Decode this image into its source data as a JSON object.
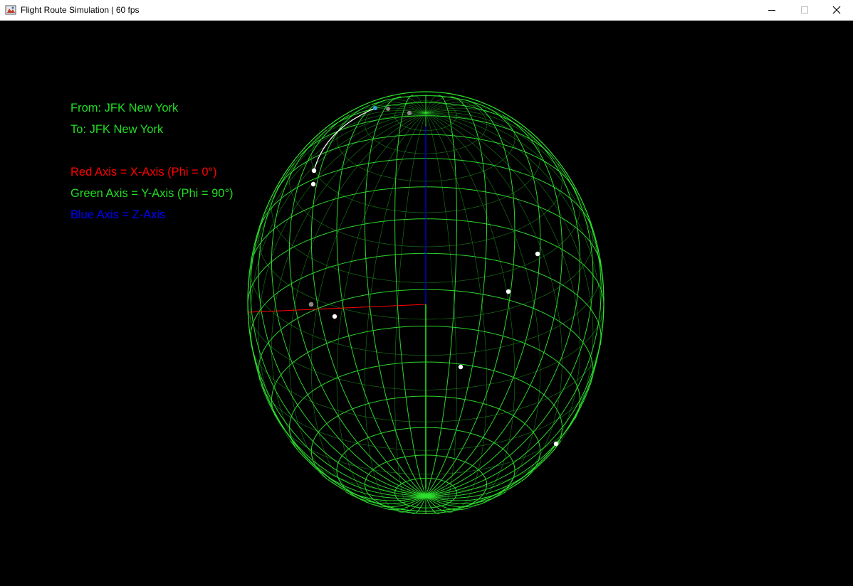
{
  "window": {
    "title": "Flight Route Simulation | 60 fps",
    "controls": {
      "minimize_icon": "minimize-icon",
      "maximize_icon": "maximize-icon",
      "close_icon": "close-icon"
    }
  },
  "overlay": {
    "from_label": "From: JFK New York",
    "to_label": "To: JFK New York",
    "red_axis_label": "Red Axis = X-Axis (Phi = 0°)",
    "green_axis_label": "Green Axis = Y-Axis (Phi = 90°)",
    "blue_axis_label": "Blue Axis = Z-Axis"
  },
  "colors": {
    "background": "#000000",
    "wireframe": "#2ee02e",
    "from_to_text": "#22dd22",
    "red_axis": "#ff0000",
    "green_axis": "#22dd22",
    "blue_axis": "#0000ff",
    "city_marker": "#ffffff",
    "inactive_marker": "#888888",
    "plane_marker": "#3a9fd8"
  },
  "globe": {
    "meridians": 36,
    "parallels": 18
  }
}
